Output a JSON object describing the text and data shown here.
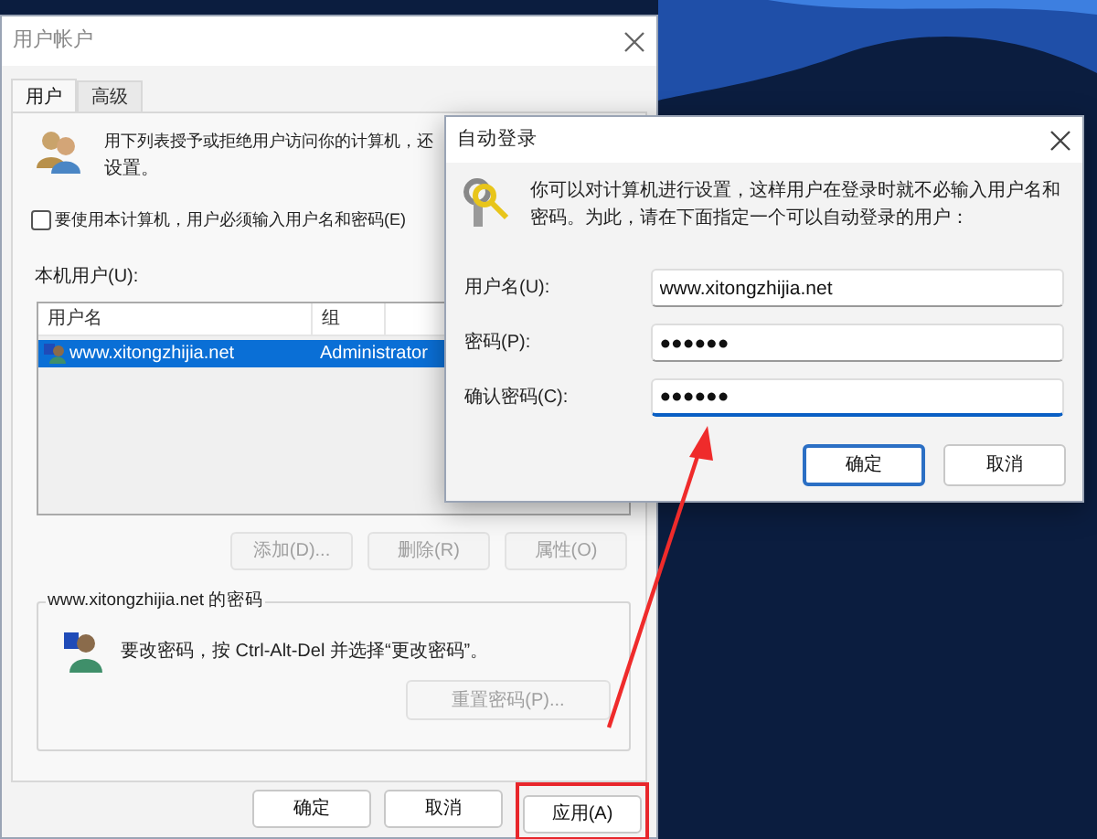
{
  "main_window": {
    "title": "用户帐户",
    "tabs": [
      {
        "label": "用户",
        "selected": true
      },
      {
        "label": "高级",
        "selected": false
      }
    ],
    "intro": [
      "用下列表授予或拒绝用户访问你的计算机，还",
      "设置。"
    ],
    "require_login": {
      "label": "要使用本计算机，用户必须输入用户名和密码(E)",
      "checked": false
    },
    "users_label": "本机用户(U):",
    "table": {
      "columns": [
        "用户名",
        "组"
      ],
      "rows": [
        {
          "cells": [
            "www.xitongzhijia.net",
            "Administrator"
          ],
          "selected": true
        }
      ]
    },
    "list_buttons": [
      {
        "label": "添加(D)...",
        "disabled": true
      },
      {
        "label": "删除(R)",
        "disabled": true
      },
      {
        "label": "属性(O)",
        "disabled": true
      }
    ],
    "password_group": {
      "title": "www.xitongzhijia.net 的密码",
      "text": "要改密码，按 Ctrl-Alt-Del 并选择“更改密码”。",
      "button": {
        "label": "重置密码(P)...",
        "disabled": true
      }
    },
    "buttons": [
      {
        "label": "确定",
        "highlighted": false
      },
      {
        "label": "取消",
        "highlighted": false
      },
      {
        "label": "应用(A)",
        "highlighted": true
      }
    ]
  },
  "autologon_dialog": {
    "title": "自动登录",
    "text": "你可以对计算机进行设置，这样用户在登录时就不必输入用户名和密码。为此，请在下面指定一个可以自动登录的用户：",
    "fields": [
      {
        "label": "用户名(U):",
        "value": "www.xitongzhijia.net",
        "focused": false
      },
      {
        "label": "密码(P):",
        "value": "●●●●●●",
        "focused": false
      },
      {
        "label": "确认密码(C):",
        "value": "●●●●●●",
        "focused": true
      }
    ],
    "buttons": [
      {
        "label": "确定",
        "default": true
      },
      {
        "label": "取消",
        "default": false
      }
    ]
  },
  "annotations": [
    {
      "kind": "arrow"
    }
  ]
}
